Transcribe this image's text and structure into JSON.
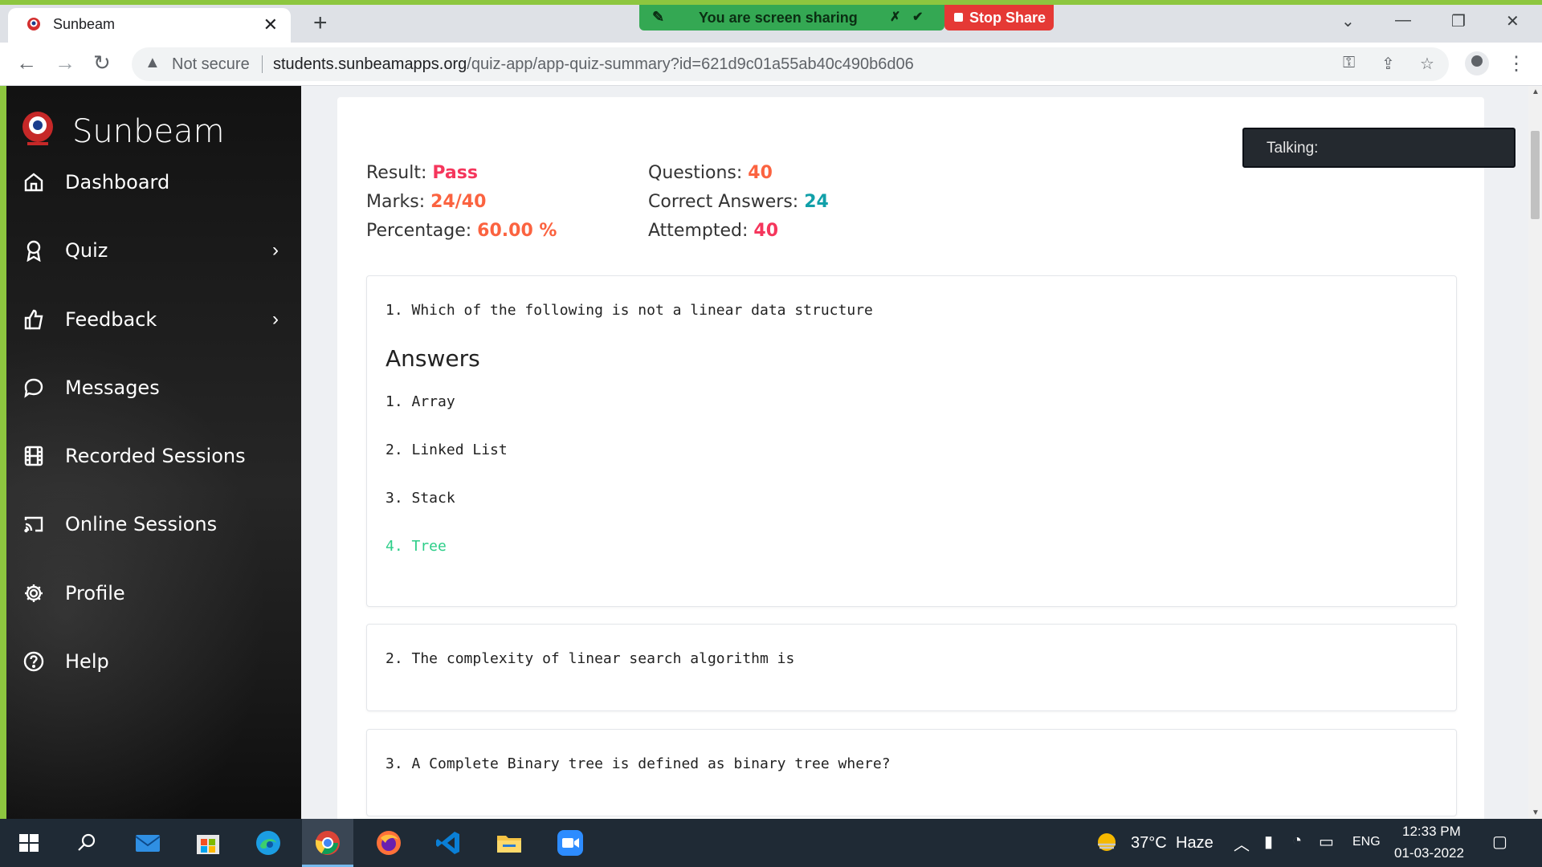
{
  "browser": {
    "tab_title": "Sunbeam",
    "tab_close": "✕",
    "new_tab": "+",
    "screen_share_text": "You are screen sharing",
    "stop_share_label": "Stop Share",
    "security_label": "Not secure",
    "url_host": "students.sunbeamapps.org",
    "url_path": "/quiz-app/app-quiz-summary?id=621d9c01a55ab40c490b6d06"
  },
  "sidebar": {
    "brand": "Sunbeam",
    "items": [
      {
        "label": "Dashboard",
        "icon": "home-icon",
        "chevron": ""
      },
      {
        "label": "Quiz",
        "icon": "award-icon",
        "chevron": "›"
      },
      {
        "label": "Feedback",
        "icon": "thumbs-up-icon",
        "chevron": "›"
      },
      {
        "label": "Messages",
        "icon": "message-icon",
        "chevron": ""
      },
      {
        "label": "Recorded Sessions",
        "icon": "film-icon",
        "chevron": ""
      },
      {
        "label": "Online Sessions",
        "icon": "cast-icon",
        "chevron": ""
      },
      {
        "label": "Profile",
        "icon": "gear-icon",
        "chevron": ""
      },
      {
        "label": "Help",
        "icon": "help-icon",
        "chevron": ""
      }
    ]
  },
  "summary": {
    "result_label": "Result: ",
    "result_value": "Pass",
    "marks_label": "Marks: ",
    "marks_value": "24/40",
    "percentage_label": "Percentage: ",
    "percentage_value": "60.00 %",
    "questions_label": "Questions: ",
    "questions_value": "40",
    "correct_label": "Correct Answers: ",
    "correct_value": "24",
    "attempted_label": "Attempted: ",
    "attempted_value": "40"
  },
  "talking": "Talking:",
  "questions": [
    {
      "text": "1. Which of the following is not a linear data structure",
      "answers_title": "Answers",
      "options": [
        "1. Array",
        "2. Linked List",
        "3. Stack",
        "4. Tree"
      ],
      "correct_index": 3
    },
    {
      "text": "2. The complexity of linear search algorithm is"
    },
    {
      "text": "3. A Complete Binary tree is defined as binary tree where?"
    }
  ],
  "taskbar": {
    "weather_temp": "37°C",
    "weather_text": "Haze",
    "lang": "ENG",
    "time": "12:33 PM",
    "date": "01-03-2022"
  },
  "colors": {
    "pass": "#f5365c",
    "marks": "#fb6340",
    "correct_answers": "#11a0a9",
    "correct_option": "#2dce89",
    "share_bar": "#34a853",
    "stop_share": "#e53935"
  }
}
